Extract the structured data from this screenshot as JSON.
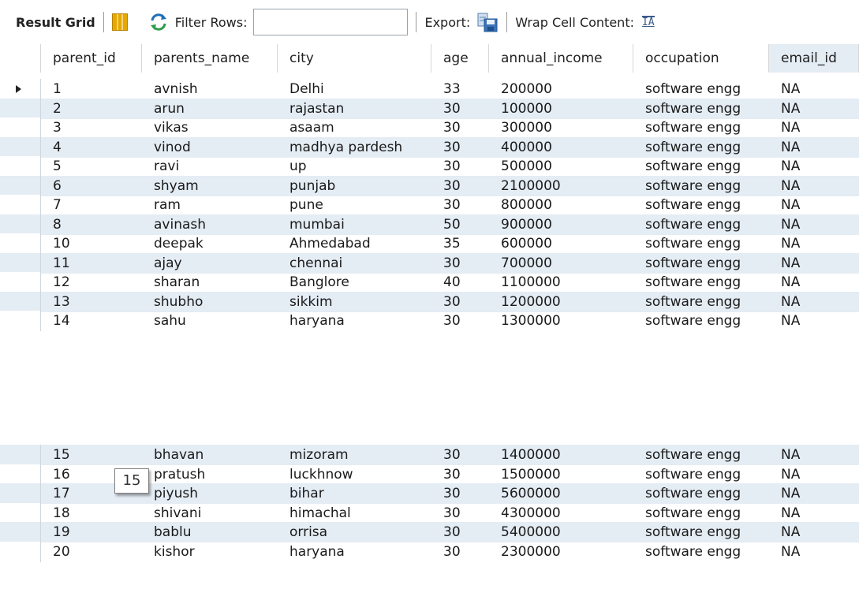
{
  "toolbar": {
    "result_grid_label": "Result Grid",
    "filter_rows_label": "Filter Rows:",
    "filter_rows_value": "",
    "export_label": "Export:",
    "wrap_cell_content_label": "Wrap Cell Content:",
    "wrap_icon_glyph": "IA"
  },
  "columns": [
    "parent_id",
    "parents_name",
    "city",
    "age",
    "annual_income",
    "occupation",
    "email_id"
  ],
  "rows": [
    [
      "1",
      "avnish",
      "Delhi",
      "33",
      "200000",
      "software engg",
      "NA"
    ],
    [
      "2",
      "arun",
      "rajastan",
      "30",
      "100000",
      "software engg",
      "NA"
    ],
    [
      "3",
      "vikas",
      "asaam",
      "30",
      "300000",
      "software engg",
      "NA"
    ],
    [
      "4",
      "vinod",
      "madhya pardesh",
      "30",
      "400000",
      "software engg",
      "NA"
    ],
    [
      "5",
      "ravi",
      "up",
      "30",
      "500000",
      "software engg",
      "NA"
    ],
    [
      "6",
      "shyam",
      "punjab",
      "30",
      "2100000",
      "software engg",
      "NA"
    ],
    [
      "7",
      "ram",
      "pune",
      "30",
      "800000",
      "software engg",
      "NA"
    ],
    [
      "8",
      "avinash",
      "mumbai",
      "50",
      "900000",
      "software engg",
      "NA"
    ],
    [
      "10",
      "deepak",
      "Ahmedabad",
      "35",
      "600000",
      "software engg",
      "NA"
    ],
    [
      "11",
      "ajay",
      "chennai",
      "30",
      "700000",
      "software engg",
      "NA"
    ],
    [
      "12",
      "sharan",
      "Banglore",
      "40",
      "1100000",
      "software engg",
      "NA"
    ],
    [
      "13",
      "shubho",
      "sikkim",
      "30",
      "1200000",
      "software engg",
      "NA"
    ],
    [
      "14",
      "sahu",
      "haryana",
      "30",
      "1300000",
      "software engg",
      "NA"
    ],
    [
      "15",
      "bhavan",
      "mizoram",
      "30",
      "1400000",
      "software engg",
      "NA"
    ],
    [
      "16",
      "pratush",
      "luckhnow",
      "30",
      "1500000",
      "software engg",
      "NA"
    ],
    [
      "17",
      "piyush",
      "bihar",
      "30",
      "5600000",
      "software engg",
      "NA"
    ],
    [
      "18",
      "shivani",
      "himachal",
      "30",
      "4300000",
      "software engg",
      "NA"
    ],
    [
      "19",
      "bablu",
      "orrisa",
      "30",
      "5400000",
      "software engg",
      "NA"
    ],
    [
      "20",
      "kishor",
      "haryana",
      "30",
      "2300000",
      "software engg",
      "NA"
    ]
  ],
  "tooltip": {
    "text": "15"
  },
  "colors": {
    "alt_row": "#e4ecf4",
    "accent": "#1f6fb5"
  }
}
